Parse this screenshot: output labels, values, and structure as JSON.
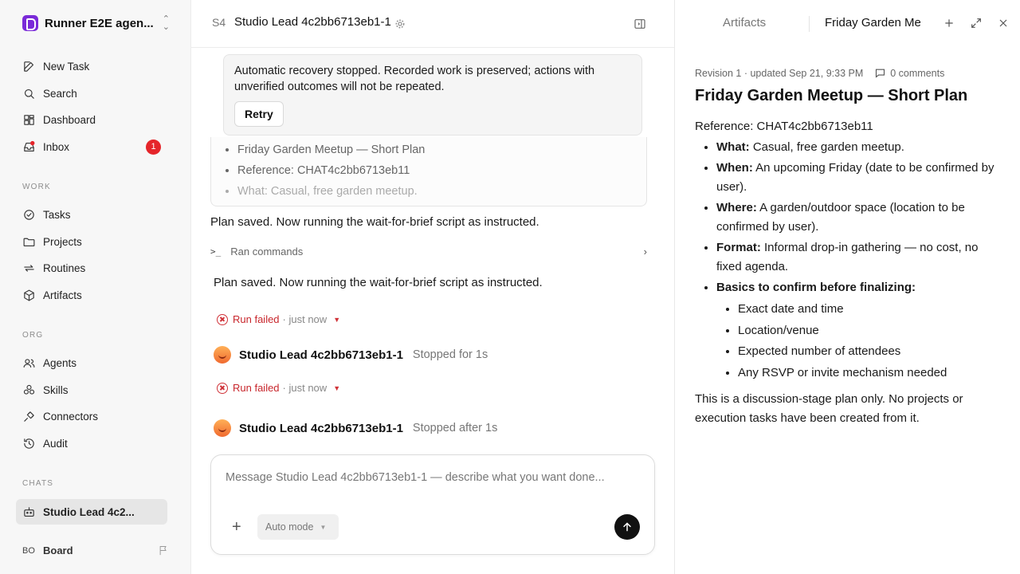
{
  "sidebar": {
    "workspace": "Runner E2E agen...",
    "nav": [
      {
        "label": "New Task",
        "icon": "edit-icon"
      },
      {
        "label": "Search",
        "icon": "search-icon"
      },
      {
        "label": "Dashboard",
        "icon": "dashboard-icon"
      },
      {
        "label": "Inbox",
        "icon": "inbox-icon",
        "badge": "1"
      }
    ],
    "work_heading": "WORK",
    "work": [
      {
        "label": "Tasks",
        "icon": "check-circle-icon"
      },
      {
        "label": "Projects",
        "icon": "folder-icon"
      },
      {
        "label": "Routines",
        "icon": "repeat-icon"
      },
      {
        "label": "Artifacts",
        "icon": "cube-icon"
      }
    ],
    "org_heading": "ORG",
    "org": [
      {
        "label": "Agents",
        "icon": "users-icon"
      },
      {
        "label": "Skills",
        "icon": "skills-icon"
      },
      {
        "label": "Connectors",
        "icon": "plug-icon"
      },
      {
        "label": "Audit",
        "icon": "history-icon"
      }
    ],
    "chats_heading": "CHATS",
    "chats": [
      {
        "label": "Studio Lead 4c2...",
        "icon": "bot-icon"
      }
    ],
    "board": {
      "initials": "BO",
      "label": "Board"
    }
  },
  "main": {
    "header": {
      "prefix": "S4",
      "title": "Studio Lead 4c2bb6713eb1-1"
    },
    "recovery": {
      "message": "Automatic recovery stopped. Recorded work is preserved; actions with unverified outcomes will not be repeated.",
      "retry_label": "Retry"
    },
    "artifact_preview": [
      "Friday Garden Meetup — Short Plan",
      "Reference: CHAT4c2bb6713eb11",
      "What: Casual, free garden meetup."
    ],
    "message1": "Plan saved. Now running the wait-for-brief script as instructed.",
    "ran_commands": "Ran commands",
    "message2": "Plan saved. Now running the wait-for-brief script as instructed.",
    "run_failed_1": {
      "label": "Run failed",
      "time": "· just now"
    },
    "agent_1": {
      "name": "Studio Lead 4c2bb6713eb1-1",
      "state": "Stopped for 1s"
    },
    "run_failed_2": {
      "label": "Run failed",
      "time": "· just now"
    },
    "agent_2": {
      "name": "Studio Lead 4c2bb6713eb1-1",
      "state": "Stopped after 1s"
    },
    "composer": {
      "placeholder": "Message Studio Lead 4c2bb6713eb1-1 — describe what you want done...",
      "mode": "Auto mode"
    }
  },
  "panel": {
    "tab_artifacts": "Artifacts",
    "tab_doc": "Friday Garden Meetup — Short Plan",
    "meta": "Revision 1 · updated Sep 21, 9:33 PM",
    "comments": "0 comments",
    "title": "Friday Garden Meetup — Short Plan",
    "reference": "Reference: CHAT4c2bb6713eb11",
    "bullets": [
      {
        "key": "What:",
        "text": " Casual, free garden meetup."
      },
      {
        "key": "When:",
        "text": " An upcoming Friday (date to be confirmed by user)."
      },
      {
        "key": "Where:",
        "text": " A garden/outdoor space (location to be confirmed by user)."
      },
      {
        "key": "Format:",
        "text": " Informal drop-in gathering — no cost, no fixed agenda."
      },
      {
        "key": "Basics to confirm before finalizing:",
        "text": ""
      }
    ],
    "sub_bullets": [
      "Exact date and time",
      "Location/venue",
      "Expected number of attendees",
      "Any RSVP or invite mechanism needed"
    ],
    "footer": "This is a discussion-stage plan only. No projects or execution tasks have been created from it."
  }
}
